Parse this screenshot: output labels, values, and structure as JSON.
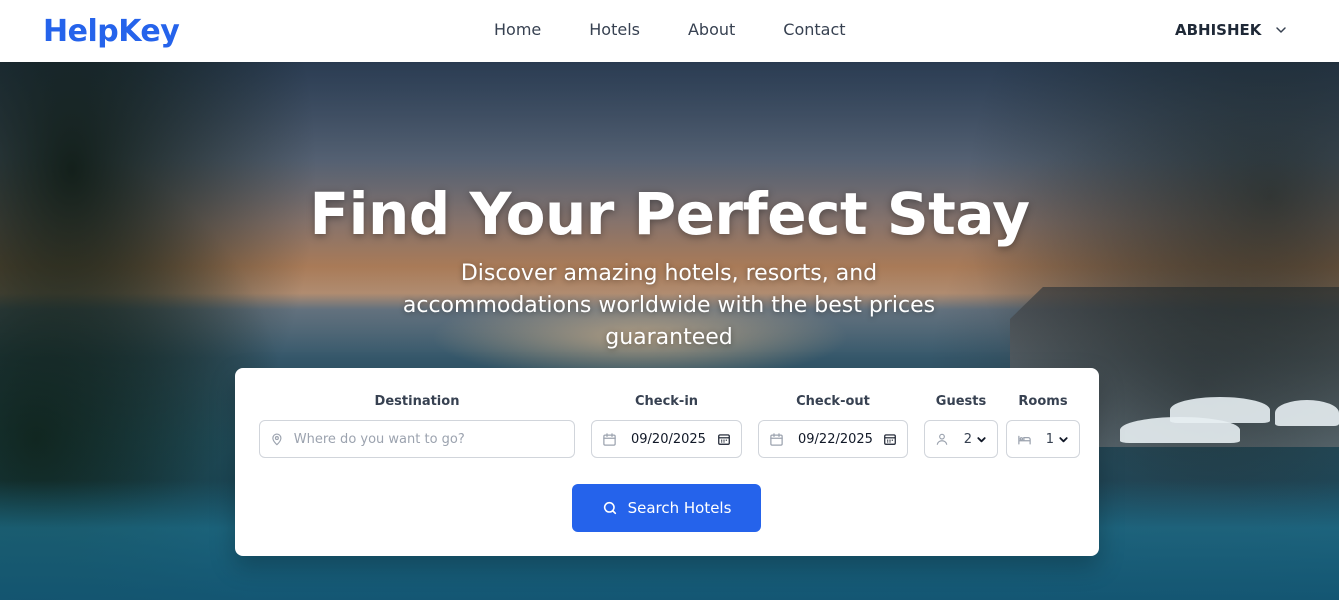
{
  "brand": {
    "name": "HelpKey",
    "color": "#2563eb"
  },
  "nav": {
    "links": [
      "Home",
      "Hotels",
      "About",
      "Contact"
    ],
    "user": "ABHISHEK"
  },
  "hero": {
    "title": "Find Your Perfect Stay",
    "subtitle": "Discover amazing hotels, resorts, and accommodations worldwide with the best prices guaranteed"
  },
  "search": {
    "destination": {
      "label": "Destination",
      "placeholder": "Where do you want to go?",
      "value": ""
    },
    "checkin": {
      "label": "Check-in",
      "value": "09/20/2025"
    },
    "checkout": {
      "label": "Check-out",
      "value": "09/22/2025"
    },
    "guests": {
      "label": "Guests",
      "value": "2"
    },
    "rooms": {
      "label": "Rooms",
      "value": "1"
    },
    "button": "Search Hotels"
  },
  "icons": {
    "destination": "map-pin-icon",
    "checkin": "calendar-icon",
    "checkout": "calendar-icon",
    "guests": "user-icon",
    "rooms": "bed-icon",
    "search": "search-icon",
    "user_menu": "chevron-down-icon"
  }
}
